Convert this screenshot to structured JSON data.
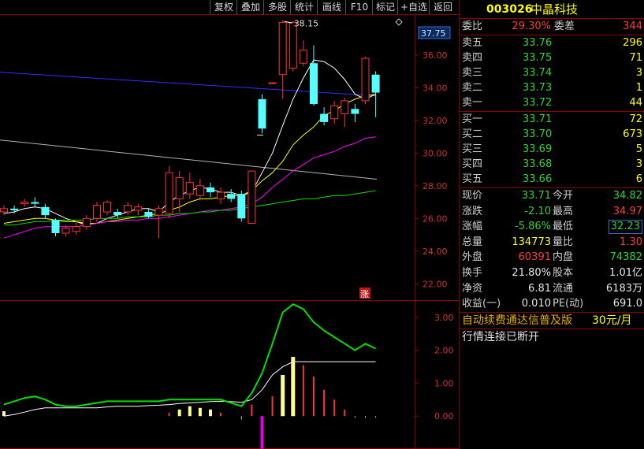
{
  "toolbar": [
    {
      "label": "复权",
      "key": "fuquan"
    },
    {
      "label": "叠加",
      "key": "diejia"
    },
    {
      "label": "多股",
      "key": "duogu"
    },
    {
      "label": "统计",
      "key": "tongji"
    },
    {
      "label": "画线",
      "key": "huaxian"
    },
    {
      "label": "F10",
      "key": "f10"
    },
    {
      "label": "标记",
      "key": "biaoji"
    },
    {
      "label": "+自选",
      "key": "zixuan"
    },
    {
      "label": "返回",
      "key": "fanhui"
    }
  ],
  "quote": {
    "code": "003026",
    "name": "中晶科技",
    "weibi_label": "委比",
    "weibi": "29.30%",
    "weicha_label": "委差",
    "weicha": "344",
    "sell": [
      {
        "label": "卖五",
        "price": "33.76",
        "vol": "296"
      },
      {
        "label": "卖四",
        "price": "33.75",
        "vol": "71"
      },
      {
        "label": "卖三",
        "price": "33.74",
        "vol": "3"
      },
      {
        "label": "卖二",
        "price": "33.73",
        "vol": "1"
      },
      {
        "label": "卖一",
        "price": "33.72",
        "vol": "44"
      }
    ],
    "buy": [
      {
        "label": "买一",
        "price": "33.71",
        "vol": "72"
      },
      {
        "label": "买二",
        "price": "33.70",
        "vol": "673"
      },
      {
        "label": "买三",
        "price": "33.69",
        "vol": "5"
      },
      {
        "label": "买四",
        "price": "33.68",
        "vol": "3"
      },
      {
        "label": "买五",
        "price": "33.66",
        "vol": "6"
      }
    ],
    "stats": [
      {
        "l1": "现价",
        "v1": "33.71",
        "l2": "今开",
        "v2": "34.82"
      },
      {
        "l1": "涨跌",
        "v1": "-2.10",
        "l2": "最高",
        "v2": "34.97"
      },
      {
        "l1": "涨幅",
        "v1": "-5.86%",
        "l2": "最低",
        "v2": "32.23"
      },
      {
        "l1": "总量",
        "v1": "134773",
        "l2": "量比",
        "v2": "1.30"
      },
      {
        "l1": "外盘",
        "v1": "60391",
        "l2": "内盘",
        "v2": "74382"
      },
      {
        "l1": "换手",
        "v1": "21.80%",
        "l2": "股本",
        "v2": "1.01亿"
      },
      {
        "l1": "净资",
        "v1": "6.81",
        "l2": "流通",
        "v2": "6183万"
      },
      {
        "l1": "收益(一)",
        "v1": "0.010",
        "l2": "PE(动)",
        "v2": "691.0"
      }
    ],
    "promo_text": "自动续费通达信普及版",
    "promo_price": "30元/月",
    "status": "行情连接已断开"
  },
  "chart_data": {
    "type": "candlestick",
    "price_axis": {
      "min": 21,
      "max": 38.5,
      "ticks": [
        "22.00",
        "24.00",
        "26.00",
        "28.00",
        "30.00",
        "32.00",
        "34.00",
        "36.00"
      ],
      "current": "37.75"
    },
    "high_label": "38.15",
    "limit_badge": "涨",
    "candles": [
      {
        "o": 26.4,
        "c": 26.6,
        "h": 26.8,
        "l": 26.2
      },
      {
        "o": 26.6,
        "c": 26.5,
        "h": 26.8,
        "l": 26.3
      },
      {
        "o": 26.9,
        "c": 27.0,
        "h": 27.2,
        "l": 26.7
      },
      {
        "o": 27.0,
        "c": 26.9,
        "h": 27.3,
        "l": 26.7
      },
      {
        "o": 26.7,
        "c": 26.2,
        "h": 26.9,
        "l": 26.0
      },
      {
        "o": 25.9,
        "c": 25.1,
        "h": 26.0,
        "l": 24.9
      },
      {
        "o": 25.1,
        "c": 25.4,
        "h": 25.6,
        "l": 24.9
      },
      {
        "o": 25.2,
        "c": 25.5,
        "h": 25.8,
        "l": 25.0
      },
      {
        "o": 25.5,
        "c": 26.0,
        "h": 26.2,
        "l": 25.3
      },
      {
        "o": 26.0,
        "c": 26.8,
        "h": 27.0,
        "l": 25.8
      },
      {
        "o": 26.4,
        "c": 27.0,
        "h": 27.1,
        "l": 26.2
      },
      {
        "o": 26.4,
        "c": 26.2,
        "h": 26.6,
        "l": 26.0
      },
      {
        "o": 26.4,
        "c": 26.8,
        "h": 27.0,
        "l": 26.2
      },
      {
        "o": 26.5,
        "c": 26.7,
        "h": 26.9,
        "l": 26.2
      },
      {
        "o": 26.4,
        "c": 26.1,
        "h": 26.6,
        "l": 26.0
      },
      {
        "o": 26.2,
        "c": 26.6,
        "h": 26.8,
        "l": 24.8
      },
      {
        "o": 26.3,
        "c": 28.8,
        "h": 29.2,
        "l": 26.0
      },
      {
        "o": 27.2,
        "c": 28.5,
        "h": 28.9,
        "l": 26.4
      },
      {
        "o": 27.5,
        "c": 28.2,
        "h": 28.8,
        "l": 27.2
      },
      {
        "o": 27.4,
        "c": 28.0,
        "h": 28.4,
        "l": 27.1
      },
      {
        "o": 27.9,
        "c": 27.6,
        "h": 28.2,
        "l": 27.3
      },
      {
        "o": 27.2,
        "c": 27.6,
        "h": 27.9,
        "l": 26.9
      },
      {
        "o": 27.5,
        "c": 27.2,
        "h": 27.8,
        "l": 27.0
      },
      {
        "o": 27.5,
        "c": 26.0,
        "h": 27.7,
        "l": 25.8
      },
      {
        "o": 25.7,
        "c": 28.9,
        "h": 28.9,
        "l": 25.7
      },
      {
        "o": 33.3,
        "c": 31.5,
        "h": 33.6,
        "l": 31.2
      },
      {
        "o": 34.3,
        "c": 34.3,
        "h": 34.3,
        "l": 34.3
      },
      {
        "o": 34.8,
        "c": 38.0,
        "h": 38.15,
        "l": 33.3
      },
      {
        "o": 35.2,
        "c": 38.0,
        "h": 38.1,
        "l": 35.0
      },
      {
        "o": 35.5,
        "c": 36.3,
        "h": 36.9,
        "l": 35.3
      },
      {
        "o": 35.5,
        "c": 33.0,
        "h": 36.6,
        "l": 32.9
      },
      {
        "o": 32.4,
        "c": 31.9,
        "h": 32.8,
        "l": 31.7
      },
      {
        "o": 32.1,
        "c": 32.9,
        "h": 33.2,
        "l": 31.8
      },
      {
        "o": 32.4,
        "c": 33.2,
        "h": 33.4,
        "l": 31.6
      },
      {
        "o": 32.7,
        "c": 32.4,
        "h": 33.0,
        "l": 31.9
      },
      {
        "o": 33.2,
        "c": 35.8,
        "h": 35.9,
        "l": 33.0
      },
      {
        "o": 34.8,
        "c": 33.7,
        "h": 35.0,
        "l": 32.2
      }
    ],
    "ma": [
      {
        "name": "MA5",
        "color": "#ffffff",
        "values": [
          26.3,
          26.4,
          26.6,
          26.7,
          26.6,
          26.3,
          26.0,
          25.8,
          25.6,
          25.7,
          26.0,
          26.2,
          26.4,
          26.6,
          26.6,
          26.4,
          27.0,
          27.4,
          27.7,
          27.9,
          27.8,
          27.6,
          27.6,
          27.4,
          27.6,
          28.8,
          30.0,
          31.7,
          33.3,
          34.6,
          35.7,
          35.6,
          35.2,
          34.5,
          33.6,
          33.3,
          33.6
        ]
      },
      {
        "name": "MA10",
        "color": "#ffff00",
        "values": [
          25.7,
          25.8,
          25.9,
          26.0,
          26.0,
          25.9,
          25.8,
          25.8,
          25.7,
          25.7,
          25.8,
          25.9,
          26.0,
          26.1,
          26.2,
          26.3,
          26.5,
          26.7,
          27.0,
          27.2,
          27.2,
          27.3,
          27.4,
          27.4,
          27.7,
          28.3,
          28.8,
          29.5,
          30.5,
          31.1,
          31.6,
          32.3,
          32.6,
          33.0,
          33.3,
          33.5,
          33.6
        ]
      },
      {
        "name": "MA20",
        "color": "#ff00ff",
        "values": [
          24.8,
          25.0,
          25.2,
          25.4,
          25.5,
          25.5,
          25.5,
          25.5,
          25.6,
          25.7,
          25.8,
          25.8,
          25.9,
          25.9,
          26.0,
          26.0,
          26.1,
          26.2,
          26.3,
          26.4,
          26.5,
          26.5,
          26.6,
          26.7,
          26.9,
          27.3,
          27.9,
          28.4,
          28.9,
          29.3,
          29.7,
          29.9,
          30.1,
          30.4,
          30.6,
          30.9,
          31.0
        ]
      },
      {
        "name": "MA60",
        "color": "#00e000",
        "values": [
          25.6,
          25.6,
          25.7,
          25.8,
          25.8,
          25.9,
          25.9,
          25.9,
          25.9,
          26.0,
          26.0,
          26.0,
          26.1,
          26.1,
          26.1,
          26.2,
          26.2,
          26.3,
          26.3,
          26.4,
          26.4,
          26.5,
          26.5,
          26.6,
          26.7,
          26.8,
          26.9,
          27.0,
          27.1,
          27.2,
          27.2,
          27.3,
          27.4,
          27.4,
          27.5,
          27.6,
          27.7
        ]
      }
    ],
    "long_ma": [
      {
        "color": "#3030ff",
        "start": 34.95,
        "end": 33.5
      },
      {
        "color": "#b4b4b4",
        "start": 30.8,
        "end": 28.4
      }
    ],
    "indicator": {
      "ticks": [
        "0.00",
        "1.00",
        "2.00",
        "3.00"
      ],
      "min": -1.0,
      "max": 3.5,
      "fast": {
        "color": "#00e000",
        "values": [
          0.35,
          0.45,
          0.55,
          0.6,
          0.5,
          0.35,
          0.3,
          0.3,
          0.35,
          0.4,
          0.45,
          0.45,
          0.45,
          0.45,
          0.45,
          0.45,
          0.5,
          0.5,
          0.5,
          0.5,
          0.5,
          0.5,
          0.4,
          0.3,
          0.7,
          1.3,
          2.2,
          3.15,
          3.4,
          3.25,
          2.85,
          2.6,
          2.4,
          2.2,
          2.0,
          2.2,
          2.05
        ]
      },
      "slow": {
        "color": "#ffffff",
        "values": [
          0.0,
          0.05,
          0.12,
          0.2,
          0.25,
          0.25,
          0.25,
          0.25,
          0.25,
          0.25,
          0.28,
          0.3,
          0.3,
          0.3,
          0.32,
          0.33,
          0.35,
          0.38,
          0.4,
          0.42,
          0.44,
          0.45,
          0.44,
          0.42,
          0.5,
          0.8,
          1.25,
          1.5,
          1.65,
          1.65,
          1.65,
          1.65,
          1.65,
          1.65,
          1.65,
          1.65,
          1.65
        ]
      },
      "bars": [
        0.15,
        0,
        0,
        0,
        0,
        0,
        0,
        0,
        0,
        0,
        0,
        0,
        0,
        0,
        0,
        0,
        0.1,
        0.2,
        0.3,
        0.25,
        0.2,
        0.1,
        0,
        -0.1,
        0.35,
        -0.99,
        0.6,
        1.25,
        1.8,
        1.55,
        1.2,
        0.8,
        0.5,
        0.2,
        -0.05,
        -0.05,
        -0.05
      ]
    }
  }
}
